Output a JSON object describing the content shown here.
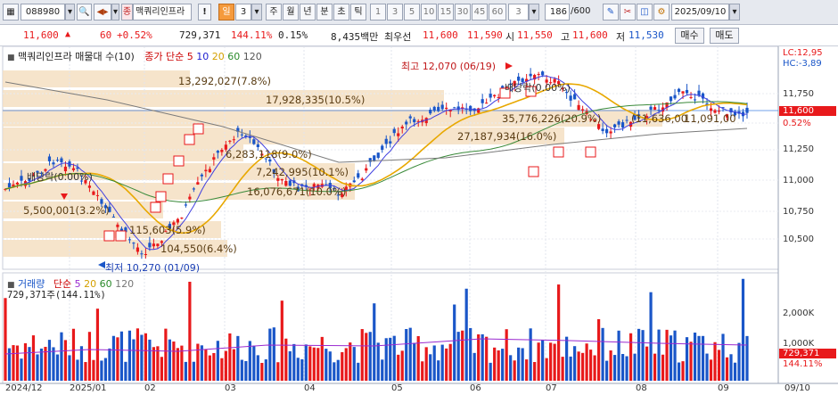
{
  "toolbar": {
    "code": "088980",
    "tag": "종",
    "stock_name": "맥쿼리인프라",
    "excl": "!",
    "period": "일",
    "period_num": "3",
    "periods": [
      "주",
      "월",
      "년",
      "분",
      "초",
      "틱"
    ],
    "intervals": [
      "1",
      "3",
      "5",
      "10",
      "15",
      "30",
      "45",
      "60"
    ],
    "interval_sel": "3",
    "count": "186",
    "count_total": "/600",
    "date": "2025/09/10"
  },
  "quote": {
    "price": "11,600",
    "change": "60",
    "change_pct": "+0.52%",
    "volume": "729,371",
    "vol_ratio": "144.11%",
    "turnover": "0.15%",
    "amount": "8,435백만",
    "best_label": "최우선",
    "ask": "11,600",
    "bid": "11,590",
    "open_label": "시",
    "open": "11,550",
    "high_label": "고",
    "high": "11,600",
    "low_label": "저",
    "low": "11,530",
    "buy_label": "매수",
    "sell_label": "매도"
  },
  "price_panel": {
    "title": "맥쿼리인프라 매물대 수(10)",
    "ma_label": "종가 단순",
    "ma_periods": [
      "5",
      "10",
      "20",
      "60",
      "120"
    ],
    "lc": "LC:12,95",
    "hc": "HC:-3,89",
    "current_price": "11,600",
    "current_pct": "0.52%",
    "y_labels": [
      "11,750",
      "11,500",
      "11,250",
      "11,000",
      "10,750",
      "10,500"
    ],
    "high_note": "최고 12,070 (06/19)",
    "low_note": "최저 10,270 (01/09)",
    "dividend_label": "배당락(0.00%)",
    "buy_marker": "B",
    "volume_profile": [
      "13,292,027(7.8%)",
      "17,928,335(10.5%)",
      "35,776,226(20.9%)",
      "27,187,934(16.0%)",
      "6,283,118(9.0%)",
      "7,242,995(10.1%)",
      "16,076,671(10.0%)",
      "5,500,001(3.2%)",
      "115,603(5.9%)",
      "104,550(6.4%)"
    ],
    "mid_note": "(11,636,00",
    "mid_note2": "11,091,00"
  },
  "volume_panel": {
    "title": "거래량",
    "ma_label": "단순",
    "ma_periods": [
      "5",
      "20",
      "60",
      "120"
    ],
    "current_text": "729,371주(144.11%)",
    "y_labels": [
      "2,000K",
      "1,000K"
    ],
    "current": "729,371",
    "current_pct": "144.11%"
  },
  "x_labels": [
    "2024/12",
    "2025/01",
    "02",
    "03",
    "04",
    "05",
    "06",
    "07",
    "08",
    "09",
    "09/10"
  ],
  "colors": {
    "up": "#e8191b",
    "down": "#1a56c8",
    "ma5": "#4040e0",
    "ma20": "#e8a800",
    "ma60": "#3a8a3a",
    "ma120": "#7a7a7a",
    "profile": "#f5dfc2"
  }
}
